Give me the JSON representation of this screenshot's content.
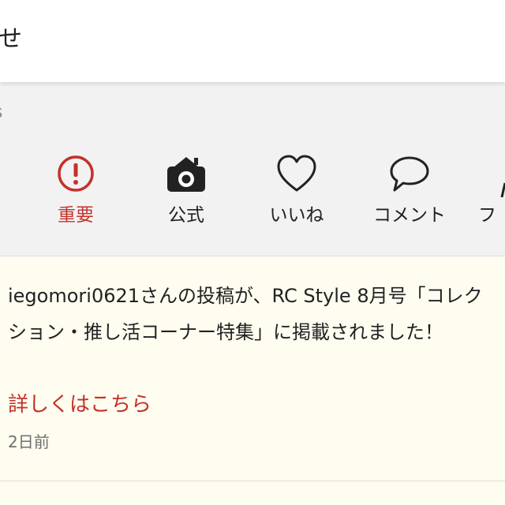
{
  "header": {
    "title": "せ"
  },
  "section": {
    "label": "s"
  },
  "tabs": [
    {
      "label": "重要",
      "icon": "exclamation-circle-icon",
      "active": true
    },
    {
      "label": "公式",
      "icon": "camera-house-icon",
      "active": false
    },
    {
      "label": "いいね",
      "icon": "heart-icon",
      "active": false
    },
    {
      "label": "コメント",
      "icon": "speech-bubble-icon",
      "active": false
    },
    {
      "label": "フ",
      "icon": "follow-icon",
      "active": false
    }
  ],
  "notifications": [
    {
      "text": "iegomori0621さんの投稿が、RC Style 8月号「コレクション・推し活コーナー特集」に掲載されました！",
      "link": "詳しくはこちら",
      "time": "2日前"
    }
  ],
  "colors": {
    "accent": "#c4312a",
    "section_bg": "#f2f2f2",
    "notification_bg": "#fffcf0"
  }
}
